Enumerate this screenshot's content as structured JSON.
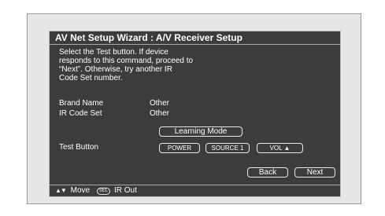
{
  "title": "AV Net Setup Wizard : A/V Receiver Setup",
  "instructions": [
    "Select the Test button.  If device",
    "responds to this command, proceed to",
    "“Next”.  Otherwise, try another IR",
    "Code Set number."
  ],
  "fields": {
    "brand_label": "Brand Name",
    "brand_value": "Other",
    "code_label": "IR Code Set",
    "code_value": "Other"
  },
  "learning_mode_label": "Learning Mode",
  "test_label": "Test Button",
  "test_buttons": [
    "POWER",
    "SOURCE 1",
    "VOL ▲"
  ],
  "nav": {
    "back": "Back",
    "next": "Next"
  },
  "footer": {
    "move_icon": "▲▼",
    "move": "Move",
    "sel_key": "SEL",
    "ir_out": "IR Out"
  }
}
